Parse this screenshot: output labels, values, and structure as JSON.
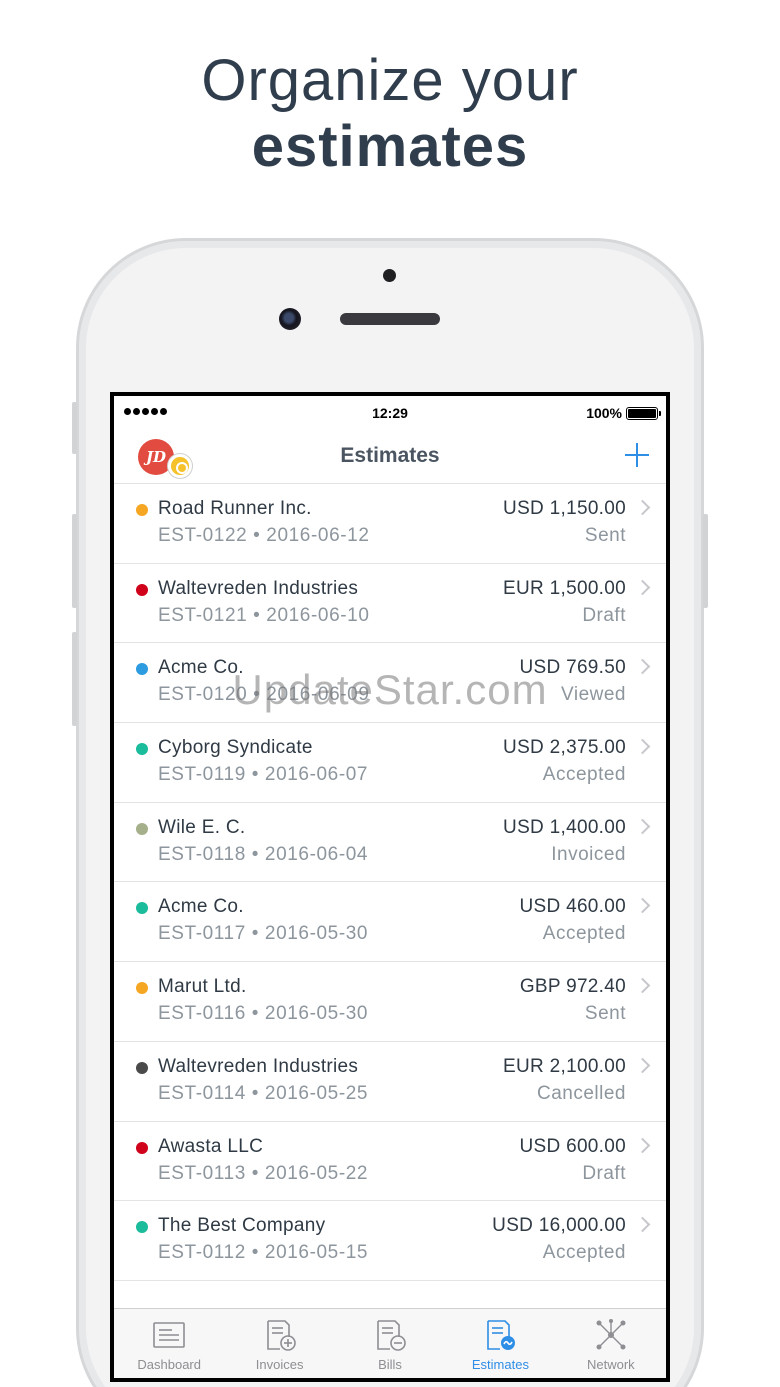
{
  "headline": {
    "line1": "Organize your",
    "line2": "estimates"
  },
  "status_bar": {
    "time": "12:29",
    "battery": "100%"
  },
  "navbar": {
    "title": "Estimates",
    "avatar_initials": "JD"
  },
  "watermark": "UpdateStar.com",
  "estimates": [
    {
      "client": "Road Runner Inc.",
      "meta": "EST-0122 • 2016-06-12",
      "amount": "USD 1,150.00",
      "status": "Sent",
      "color": "#f5a623"
    },
    {
      "client": "Waltevreden Industries",
      "meta": "EST-0121 • 2016-06-10",
      "amount": "EUR 1,500.00",
      "status": "Draft",
      "color": "#d0021b"
    },
    {
      "client": "Acme Co.",
      "meta": "EST-0120 • 2016-06-09",
      "amount": "USD 769.50",
      "status": "Viewed",
      "color": "#2d9be0"
    },
    {
      "client": "Cyborg Syndicate",
      "meta": "EST-0119 • 2016-06-07",
      "amount": "USD 2,375.00",
      "status": "Accepted",
      "color": "#1abc9c"
    },
    {
      "client": "Wile E. C.",
      "meta": "EST-0118 • 2016-06-04",
      "amount": "USD 1,400.00",
      "status": "Invoiced",
      "color": "#a5b08a"
    },
    {
      "client": "Acme Co.",
      "meta": "EST-0117 • 2016-05-30",
      "amount": "USD 460.00",
      "status": "Accepted",
      "color": "#1abc9c"
    },
    {
      "client": "Marut Ltd.",
      "meta": "EST-0116 • 2016-05-30",
      "amount": "GBP 972.40",
      "status": "Sent",
      "color": "#f5a623"
    },
    {
      "client": "Waltevreden Industries",
      "meta": "EST-0114 • 2016-05-25",
      "amount": "EUR 2,100.00",
      "status": "Cancelled",
      "color": "#4a4a4a"
    },
    {
      "client": "Awasta LLC",
      "meta": "EST-0113 • 2016-05-22",
      "amount": "USD 600.00",
      "status": "Draft",
      "color": "#d0021b"
    },
    {
      "client": "The Best Company",
      "meta": "EST-0112 • 2016-05-15",
      "amount": "USD 16,000.00",
      "status": "Accepted",
      "color": "#1abc9c"
    }
  ],
  "tabs": [
    {
      "label": "Dashboard",
      "icon": "dashboard-icon",
      "active": false
    },
    {
      "label": "Invoices",
      "icon": "invoices-icon",
      "active": false
    },
    {
      "label": "Bills",
      "icon": "bills-icon",
      "active": false
    },
    {
      "label": "Estimates",
      "icon": "estimates-icon",
      "active": true
    },
    {
      "label": "Network",
      "icon": "network-icon",
      "active": false
    }
  ],
  "colors": {
    "accent": "#2f8ee5",
    "text": "#2f3a45",
    "muted": "#8d959d"
  }
}
